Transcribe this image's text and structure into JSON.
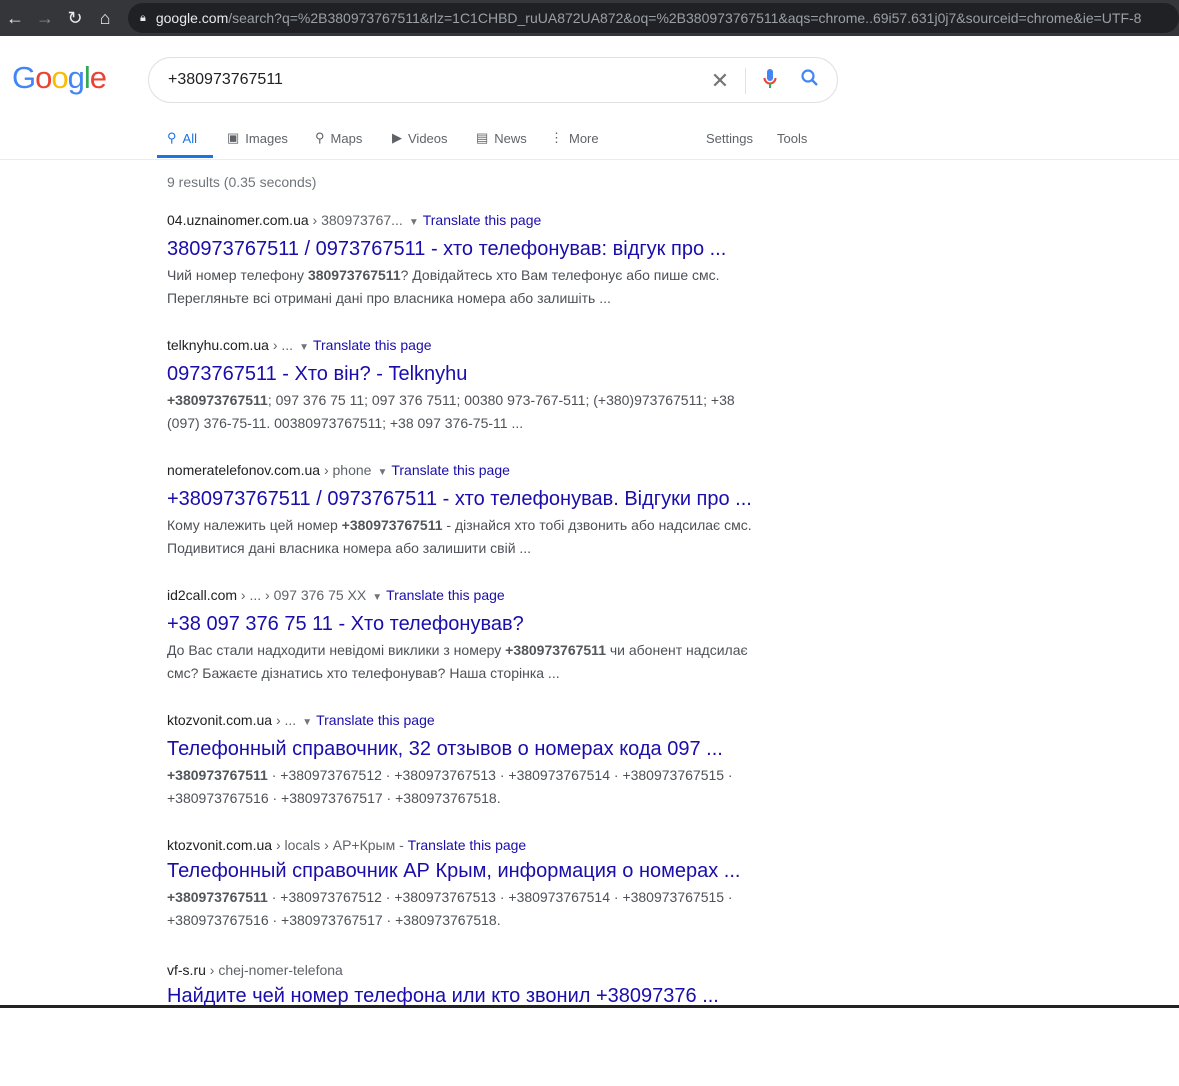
{
  "browser": {
    "url_host": "google.com",
    "url_rest": "/search?q=%2B380973767511&rlz=1C1CHBD_ruUA872UA872&oq=%2B380973767511&aqs=chrome..69i57.631j0j7&sourceid=chrome&ie=UTF-8"
  },
  "logo": "Google",
  "search": {
    "value": "+380973767511"
  },
  "tabs": [
    {
      "label": "All",
      "icon": "search-icon"
    },
    {
      "label": "Images",
      "icon": "image-icon"
    },
    {
      "label": "Maps",
      "icon": "map-pin-icon"
    },
    {
      "label": "Videos",
      "icon": "video-icon"
    },
    {
      "label": "News",
      "icon": "news-icon"
    },
    {
      "label": "More",
      "icon": "more-icon"
    }
  ],
  "tools": {
    "settings": "Settings",
    "tools": "Tools"
  },
  "result_count": "9 results (0.35 seconds)",
  "translate_label": "Translate this page",
  "results": [
    {
      "site": "04.uznainomer.com.ua",
      "path": " › 380973767...",
      "translate": true,
      "title": "380973767511 / 0973767511 - хто телефонував: відгук про ...",
      "snippet": [
        {
          "t": "Чий номер телефону "
        },
        {
          "t": "380973767511",
          "b": true
        },
        {
          "t": "? Довідайтесь хто Вам телефонує або пише смс. Перегляньте всі отримані дані про власника номера або залишіть ..."
        }
      ]
    },
    {
      "site": "telknyhu.com.ua",
      "path": " › ...",
      "translate": true,
      "title": "0973767511 - Хто він? - Telknyhu",
      "snippet": [
        {
          "t": "+380973767511",
          "b": true
        },
        {
          "t": "; 097 376 75 11; 097 376 7511; 00380 973-767-511; (+380)973767511; +38 (097) 376-75-11. 00380973767511; +38 097 376-75-11 ..."
        }
      ]
    },
    {
      "site": "nomeratelefonov.com.ua",
      "path": " › phone",
      "translate": true,
      "title": "+380973767511 / 0973767511 - хто телефонував. Відгуки про ...",
      "snippet": [
        {
          "t": "Кому належить цей номер "
        },
        {
          "t": "+380973767511",
          "b": true
        },
        {
          "t": " - дізнайся хто тобі дзвонить або надсилає смс. Подивитися дані власника номера або залишити свій ..."
        }
      ]
    },
    {
      "site": "id2call.com",
      "path": " › ... › 097 376 75 XX",
      "translate": true,
      "title": "+38 097 376 75 11 - Хто телефонував?",
      "snippet": [
        {
          "t": "До Вас стали надходити невідомі виклики з номеру "
        },
        {
          "t": "+380973767511",
          "b": true
        },
        {
          "t": " чи абонент надсилає смс? Бажаєте дізнатись хто телефонував? Наша сторінка ..."
        }
      ]
    },
    {
      "site": "ktozvonit.com.ua",
      "path": " › ...",
      "translate": true,
      "title": "Телефонный справочник, 32 отзывов о номерах кода 097 ...",
      "snippet": [
        {
          "t": "+380973767511",
          "b": true
        },
        {
          "t": " · +380973767512 · +380973767513 · +380973767514 · +380973767515 · +380973767516 · +380973767517 · +380973767518."
        }
      ]
    },
    {
      "site": "ktozvonit.com.ua",
      "path": " › locals › АР+Крым",
      "translate": true,
      "dash": true,
      "title": "Телефонный справочник АР Крым, информация о номерах ...",
      "snippet": [
        {
          "t": "+380973767511",
          "b": true
        },
        {
          "t": " · +380973767512 · +380973767513 · +380973767514 · +380973767515 · +380973767516 · +380973767517 · +380973767518."
        }
      ]
    },
    {
      "site": "vf-s.ru",
      "path": " › chej-nomer-telefona",
      "translate": false,
      "title": "Найдите чей номер телефона или кто звонил +38097376 ...",
      "snippet": []
    }
  ]
}
